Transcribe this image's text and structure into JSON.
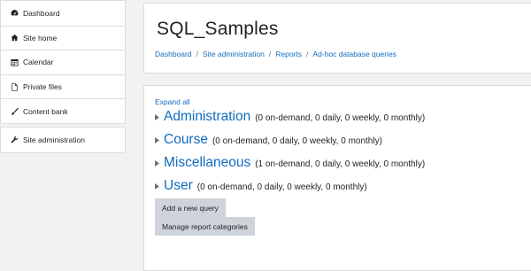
{
  "sidebar": {
    "items": [
      {
        "label": "Dashboard",
        "icon": "dashboard-icon"
      },
      {
        "label": "Site home",
        "icon": "home-icon"
      },
      {
        "label": "Calendar",
        "icon": "calendar-icon"
      },
      {
        "label": "Private files",
        "icon": "file-icon"
      },
      {
        "label": "Content bank",
        "icon": "brush-icon"
      }
    ],
    "admin": {
      "label": "Site administration",
      "icon": "wrench-icon"
    }
  },
  "header": {
    "title": "SQL_Samples",
    "breadcrumb": [
      "Dashboard",
      "Site administration",
      "Reports",
      "Ad-hoc database queries"
    ],
    "separator": "/"
  },
  "main": {
    "expand_all": "Expand all",
    "categories": [
      {
        "name": "Administration",
        "counts": "(0 on-demand, 0 daily, 0 weekly, 0 monthly)"
      },
      {
        "name": "Course",
        "counts": "(0 on-demand, 0 daily, 0 weekly, 0 monthly)"
      },
      {
        "name": "Miscellaneous",
        "counts": "(1 on-demand, 0 daily, 0 weekly, 0 monthly)"
      },
      {
        "name": "User",
        "counts": "(0 on-demand, 0 daily, 0 weekly, 0 monthly)"
      }
    ],
    "add_query_label": "Add a new query",
    "manage_categories_label": "Manage report categories"
  },
  "colors": {
    "link": "#0f6cbf",
    "button_bg": "#ced4da",
    "page_bg": "#f2f2f2"
  }
}
